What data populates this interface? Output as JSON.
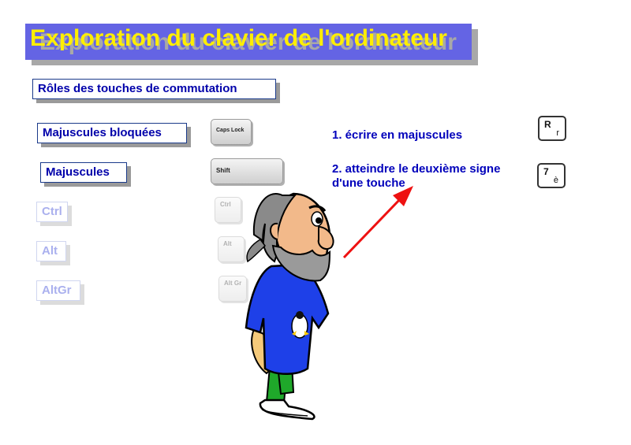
{
  "title": "Exploration du clavier de l'ordinateur",
  "section": "Rôles des touches de commutation",
  "labels": {
    "caps": "Majuscules bloquées",
    "shift": "Majuscules",
    "ctrl": "Ctrl",
    "alt": "Alt",
    "altgr": "AltGr"
  },
  "keys": {
    "caps": "Caps Lock",
    "shift": "Shift",
    "ctrl": "Ctrl",
    "alt": "Alt",
    "altgr": "Alt Gr"
  },
  "descriptions": {
    "caps": "1. écrire en majuscules",
    "shift": "2. atteindre le deuxième signe d'une touche"
  },
  "example_keys": {
    "caps": {
      "top": "R",
      "bottom": "r"
    },
    "shift": {
      "top": "7",
      "bottom": "è"
    }
  },
  "colors": {
    "title_bg": "#6464e4",
    "title_text": "#ffee00",
    "label_text": "#0000aa",
    "arrow": "#ee1111"
  }
}
